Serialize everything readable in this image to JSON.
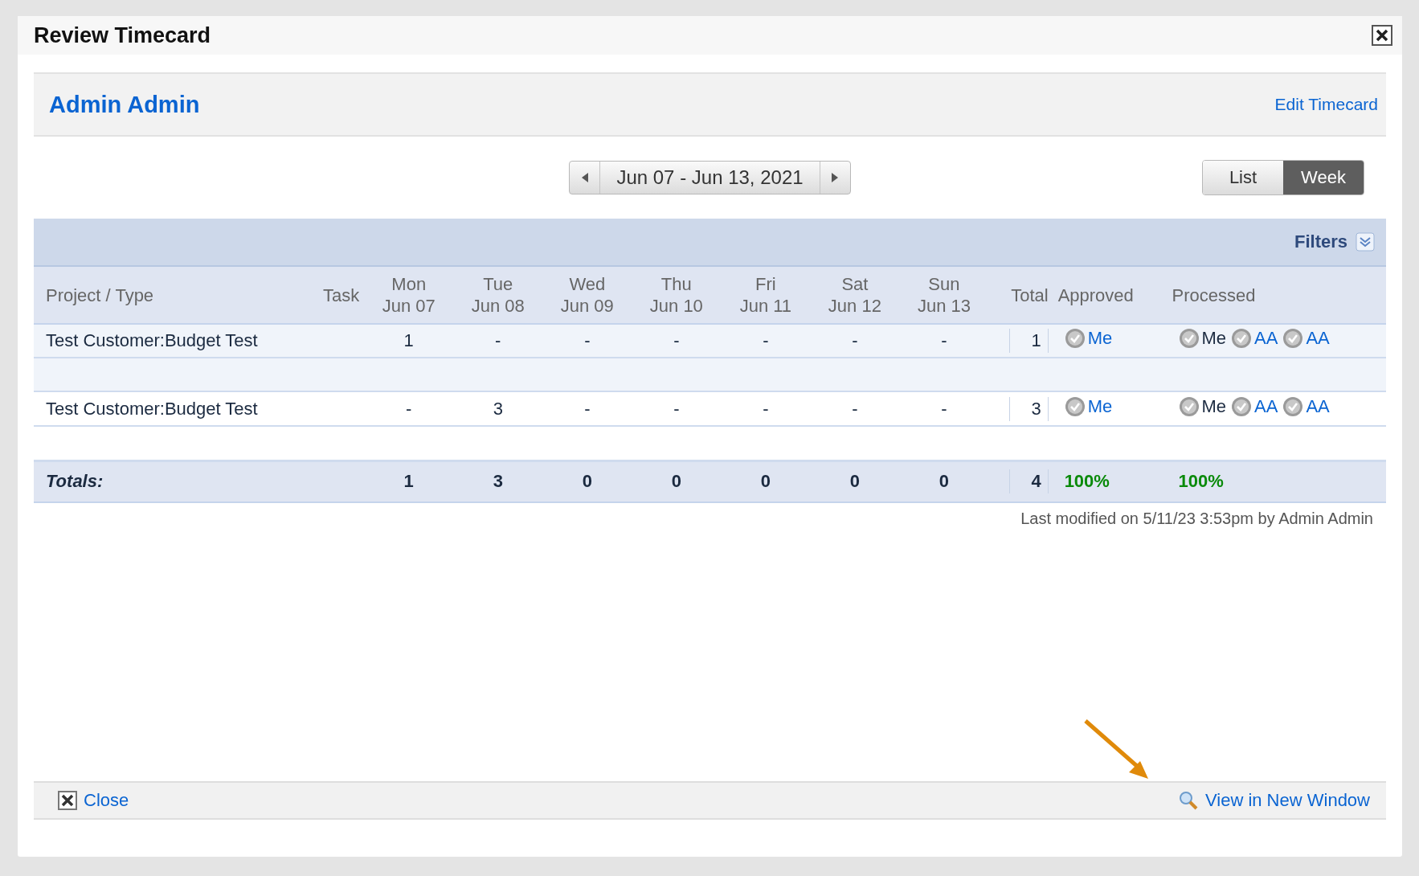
{
  "dialog": {
    "title": "Review Timecard"
  },
  "header": {
    "employee": "Admin Admin",
    "edit_link": "Edit Timecard"
  },
  "date_range": "Jun 07 - Jun 13, 2021",
  "view_toggle": [
    {
      "label": "List",
      "selected": false
    },
    {
      "label": "Week",
      "selected": true
    }
  ],
  "filters": {
    "label": "Filters"
  },
  "table": {
    "columns": [
      {
        "line1": "Project / Type"
      },
      {
        "line1": "Task"
      },
      {
        "line1": "Mon",
        "line2": "Jun 07"
      },
      {
        "line1": "Tue",
        "line2": "Jun 08"
      },
      {
        "line1": "Wed",
        "line2": "Jun 09"
      },
      {
        "line1": "Thu",
        "line2": "Jun 10"
      },
      {
        "line1": "Fri",
        "line2": "Jun 11"
      },
      {
        "line1": "Sat",
        "line2": "Jun 12"
      },
      {
        "line1": "Sun",
        "line2": "Jun 13"
      },
      {
        "line1": "Total"
      },
      {
        "line1": "Approved"
      },
      {
        "line1": "Processed"
      }
    ],
    "rows": [
      {
        "kind": "entry",
        "project": "Test Customer:Budget Test",
        "days": [
          "1",
          "-",
          "-",
          "-",
          "-",
          "-",
          "-"
        ],
        "total": "1",
        "approved": [
          {
            "label": "Me",
            "link": true
          }
        ],
        "processed": [
          {
            "label": "Me",
            "link": false
          },
          {
            "label": "AA",
            "link": true
          },
          {
            "label": "AA",
            "link": true
          }
        ]
      },
      {
        "kind": "spacer"
      },
      {
        "kind": "entry",
        "project": "Test Customer:Budget Test",
        "days": [
          "-",
          "3",
          "-",
          "-",
          "-",
          "-",
          "-"
        ],
        "total": "3",
        "approved": [
          {
            "label": "Me",
            "link": true
          }
        ],
        "processed": [
          {
            "label": "Me",
            "link": false
          },
          {
            "label": "AA",
            "link": true
          },
          {
            "label": "AA",
            "link": true
          }
        ]
      },
      {
        "kind": "spacer"
      }
    ],
    "totals": {
      "label": "Totals:",
      "days": [
        "1",
        "3",
        "0",
        "0",
        "0",
        "0",
        "0"
      ],
      "total": "4",
      "approved": "100%",
      "processed": "100%"
    }
  },
  "last_modified": "Last modified on 5/11/23 3:53pm by Admin Admin",
  "footer": {
    "close": "Close",
    "view_new_window": "View in New Window"
  }
}
